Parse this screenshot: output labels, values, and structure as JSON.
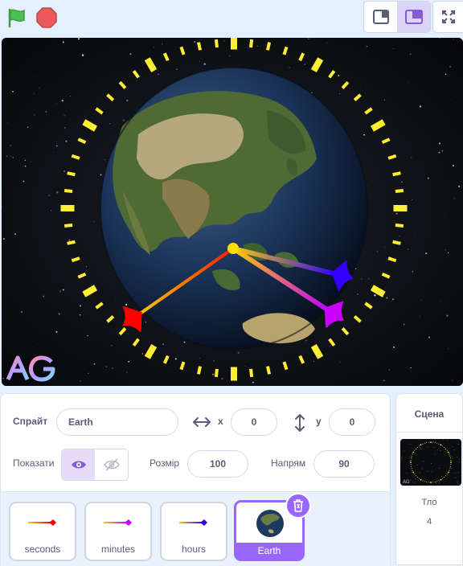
{
  "controls": {
    "green_flag_icon": "green-flag-icon",
    "stop_icon": "stop-icon",
    "small_stage_icon": "small-stage-icon",
    "normal_stage_icon": "normal-stage-icon",
    "fullscreen_icon": "fullscreen-icon"
  },
  "stage": {
    "logo_text": "AG",
    "clock_hands": [
      {
        "name": "seconds",
        "angle_deg": 235
      },
      {
        "name": "minutes",
        "angle_deg": 123
      },
      {
        "name": "hours",
        "angle_deg": 104
      }
    ]
  },
  "sprite_info": {
    "sprite_label": "Спрайт",
    "sprite_name": "Earth",
    "x_label": "x",
    "x_value": "0",
    "y_label": "y",
    "y_value": "0",
    "show_label": "Показати",
    "size_label": "Розмір",
    "size_value": "100",
    "direction_label": "Напрям",
    "direction_value": "90"
  },
  "sprites": [
    {
      "name": "seconds",
      "selected": false,
      "color": "#ff0000"
    },
    {
      "name": "minutes",
      "selected": false,
      "color": "#cc00ff"
    },
    {
      "name": "hours",
      "selected": false,
      "color": "#3300ff"
    },
    {
      "name": "Earth",
      "selected": true,
      "color": "#2a6b3a"
    }
  ],
  "stage_panel": {
    "title": "Сцена",
    "backdrop_label": "Тло",
    "backdrop_count": "4"
  },
  "colors": {
    "accent": "#9966ff",
    "tick": "#ffee33",
    "green_flag": "#4cbf56",
    "stop": "#ec5959"
  }
}
